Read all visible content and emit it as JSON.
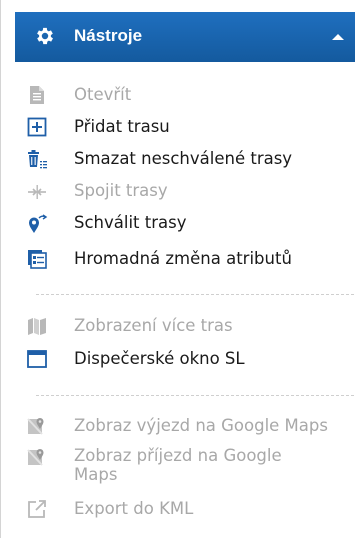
{
  "header": {
    "title": "Nástroje",
    "bg_color": "#1a65b1"
  },
  "groups": [
    {
      "items": [
        {
          "label": "Otevřít",
          "icon": "document-icon",
          "enabled": false
        },
        {
          "label": "Přidat trasu",
          "icon": "add-box-icon",
          "enabled": true
        },
        {
          "label": "Smazat neschválené trasy",
          "icon": "trash-list-icon",
          "enabled": true
        },
        {
          "label": "Spojit trasy",
          "icon": "merge-arrows-icon",
          "enabled": false
        },
        {
          "label": "Schválit trasy",
          "icon": "approve-pin-icon",
          "enabled": true
        },
        {
          "label": "Hromadná změna atributů",
          "icon": "bulk-edit-icon",
          "enabled": true
        }
      ]
    },
    {
      "items": [
        {
          "label": "Zobrazení více tras",
          "icon": "map-icon",
          "enabled": false
        },
        {
          "label": "Dispečerské okno SL",
          "icon": "window-icon",
          "enabled": true
        }
      ]
    },
    {
      "items": [
        {
          "label": "Zobraz výjezd na Google Maps",
          "icon": "google-maps-icon",
          "enabled": false
        },
        {
          "label": "Zobraz příjezd na Google Maps",
          "icon": "google-maps-icon",
          "enabled": false
        },
        {
          "label": "Export do KML",
          "icon": "export-icon",
          "enabled": false
        }
      ]
    }
  ],
  "colors": {
    "accent": "#1f5fa8",
    "disabled": "#a8a8a8",
    "text": "#1a1a1a"
  }
}
